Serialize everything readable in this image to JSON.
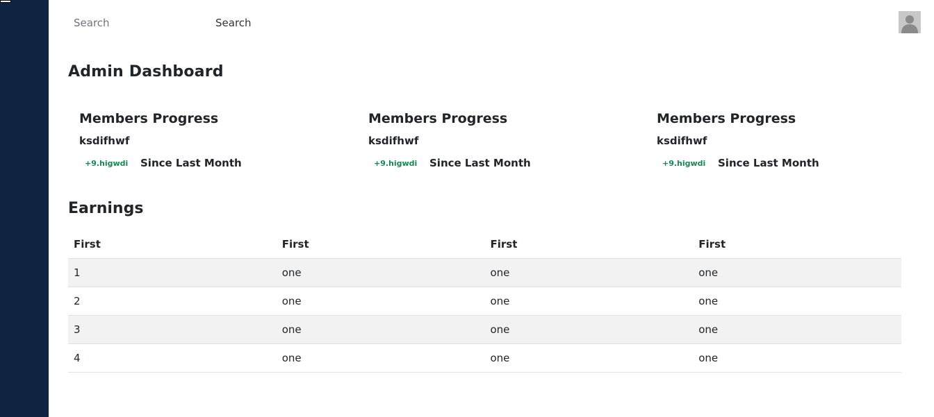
{
  "search": {
    "placeholder": "Search",
    "button_label": "Search"
  },
  "page": {
    "title": "Admin Dashboard"
  },
  "cards": [
    {
      "title": "Members Progress",
      "value": "ksdifhwf",
      "badge": "+9.higwdi",
      "since": "Since Last Month"
    },
    {
      "title": "Members Progress",
      "value": "ksdifhwf",
      "badge": "+9.higwdi",
      "since": "Since Last Month"
    },
    {
      "title": "Members Progress",
      "value": "ksdifhwf",
      "badge": "+9.higwdi",
      "since": "Since Last Month"
    }
  ],
  "earnings": {
    "title": "Earnings",
    "headers": [
      "First",
      "First",
      "First",
      "First"
    ],
    "rows": [
      [
        "1",
        "one",
        "one",
        "one"
      ],
      [
        "2",
        "one",
        "one",
        "one"
      ],
      [
        "3",
        "one",
        "one",
        "one"
      ],
      [
        "4",
        "one",
        "one",
        "one"
      ]
    ]
  },
  "colors": {
    "sidebar": "#0f2440",
    "badge": "#198754",
    "stripe": "#f2f2f2"
  },
  "icons": {
    "avatar": "user-avatar-icon"
  }
}
